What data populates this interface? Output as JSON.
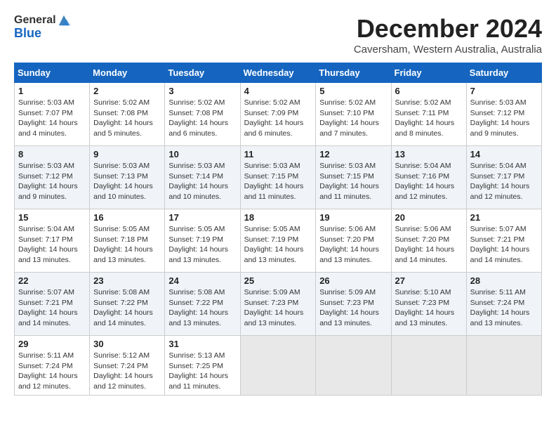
{
  "header": {
    "logo_general": "General",
    "logo_blue": "Blue",
    "title": "December 2024",
    "subtitle": "Caversham, Western Australia, Australia"
  },
  "columns": [
    "Sunday",
    "Monday",
    "Tuesday",
    "Wednesday",
    "Thursday",
    "Friday",
    "Saturday"
  ],
  "weeks": [
    [
      {
        "day": "1",
        "sunrise": "5:03 AM",
        "sunset": "7:07 PM",
        "daylight": "14 hours and 4 minutes."
      },
      {
        "day": "2",
        "sunrise": "5:02 AM",
        "sunset": "7:08 PM",
        "daylight": "14 hours and 5 minutes."
      },
      {
        "day": "3",
        "sunrise": "5:02 AM",
        "sunset": "7:08 PM",
        "daylight": "14 hours and 6 minutes."
      },
      {
        "day": "4",
        "sunrise": "5:02 AM",
        "sunset": "7:09 PM",
        "daylight": "14 hours and 6 minutes."
      },
      {
        "day": "5",
        "sunrise": "5:02 AM",
        "sunset": "7:10 PM",
        "daylight": "14 hours and 7 minutes."
      },
      {
        "day": "6",
        "sunrise": "5:02 AM",
        "sunset": "7:11 PM",
        "daylight": "14 hours and 8 minutes."
      },
      {
        "day": "7",
        "sunrise": "5:03 AM",
        "sunset": "7:12 PM",
        "daylight": "14 hours and 9 minutes."
      }
    ],
    [
      {
        "day": "8",
        "sunrise": "5:03 AM",
        "sunset": "7:12 PM",
        "daylight": "14 hours and 9 minutes."
      },
      {
        "day": "9",
        "sunrise": "5:03 AM",
        "sunset": "7:13 PM",
        "daylight": "14 hours and 10 minutes."
      },
      {
        "day": "10",
        "sunrise": "5:03 AM",
        "sunset": "7:14 PM",
        "daylight": "14 hours and 10 minutes."
      },
      {
        "day": "11",
        "sunrise": "5:03 AM",
        "sunset": "7:15 PM",
        "daylight": "14 hours and 11 minutes."
      },
      {
        "day": "12",
        "sunrise": "5:03 AM",
        "sunset": "7:15 PM",
        "daylight": "14 hours and 11 minutes."
      },
      {
        "day": "13",
        "sunrise": "5:04 AM",
        "sunset": "7:16 PM",
        "daylight": "14 hours and 12 minutes."
      },
      {
        "day": "14",
        "sunrise": "5:04 AM",
        "sunset": "7:17 PM",
        "daylight": "14 hours and 12 minutes."
      }
    ],
    [
      {
        "day": "15",
        "sunrise": "5:04 AM",
        "sunset": "7:17 PM",
        "daylight": "14 hours and 13 minutes."
      },
      {
        "day": "16",
        "sunrise": "5:05 AM",
        "sunset": "7:18 PM",
        "daylight": "14 hours and 13 minutes."
      },
      {
        "day": "17",
        "sunrise": "5:05 AM",
        "sunset": "7:19 PM",
        "daylight": "14 hours and 13 minutes."
      },
      {
        "day": "18",
        "sunrise": "5:05 AM",
        "sunset": "7:19 PM",
        "daylight": "14 hours and 13 minutes."
      },
      {
        "day": "19",
        "sunrise": "5:06 AM",
        "sunset": "7:20 PM",
        "daylight": "14 hours and 13 minutes."
      },
      {
        "day": "20",
        "sunrise": "5:06 AM",
        "sunset": "7:20 PM",
        "daylight": "14 hours and 14 minutes."
      },
      {
        "day": "21",
        "sunrise": "5:07 AM",
        "sunset": "7:21 PM",
        "daylight": "14 hours and 14 minutes."
      }
    ],
    [
      {
        "day": "22",
        "sunrise": "5:07 AM",
        "sunset": "7:21 PM",
        "daylight": "14 hours and 14 minutes."
      },
      {
        "day": "23",
        "sunrise": "5:08 AM",
        "sunset": "7:22 PM",
        "daylight": "14 hours and 14 minutes."
      },
      {
        "day": "24",
        "sunrise": "5:08 AM",
        "sunset": "7:22 PM",
        "daylight": "14 hours and 13 minutes."
      },
      {
        "day": "25",
        "sunrise": "5:09 AM",
        "sunset": "7:23 PM",
        "daylight": "14 hours and 13 minutes."
      },
      {
        "day": "26",
        "sunrise": "5:09 AM",
        "sunset": "7:23 PM",
        "daylight": "14 hours and 13 minutes."
      },
      {
        "day": "27",
        "sunrise": "5:10 AM",
        "sunset": "7:23 PM",
        "daylight": "14 hours and 13 minutes."
      },
      {
        "day": "28",
        "sunrise": "5:11 AM",
        "sunset": "7:24 PM",
        "daylight": "14 hours and 13 minutes."
      }
    ],
    [
      {
        "day": "29",
        "sunrise": "5:11 AM",
        "sunset": "7:24 PM",
        "daylight": "14 hours and 12 minutes."
      },
      {
        "day": "30",
        "sunrise": "5:12 AM",
        "sunset": "7:24 PM",
        "daylight": "14 hours and 12 minutes."
      },
      {
        "day": "31",
        "sunrise": "5:13 AM",
        "sunset": "7:25 PM",
        "daylight": "14 hours and 11 minutes."
      },
      null,
      null,
      null,
      null
    ]
  ]
}
